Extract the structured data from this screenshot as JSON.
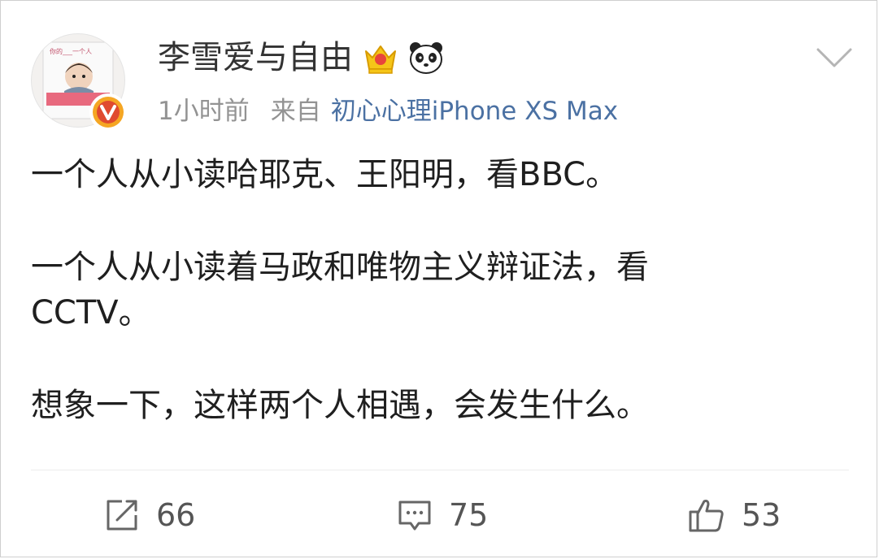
{
  "post": {
    "author": "李雪爱与自由",
    "time": "1小时前",
    "from_label": "来自",
    "source": "初心心理iPhone XS Max",
    "paragraphs": [
      "一个人从小读哈耶克、王阳明，看BBC。",
      "一个人从小读着马政和唯物主义辩证法，看CCTV。",
      "想象一下，这样两个人相遇，会发生什么。"
    ]
  },
  "avatar": {
    "book_text": "你的___一个人"
  },
  "badges": {
    "crown_icon": "crown-badge-icon",
    "panda_icon": "panda-icon",
    "verified_letter": "V",
    "verified_color": "#f5a623"
  },
  "actions": {
    "repost_count": "66",
    "comment_count": "75",
    "like_count": "53"
  }
}
